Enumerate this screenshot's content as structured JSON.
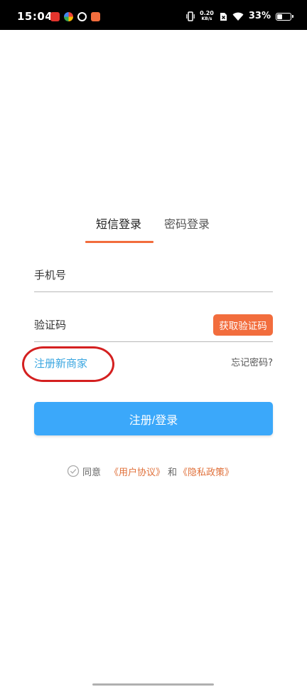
{
  "status_bar": {
    "time": "15:04",
    "net_speed_value": "0.20",
    "net_speed_unit": "KB/s",
    "battery_percent": "33%",
    "battery_level": 0.33
  },
  "tabs": [
    {
      "label": "短信登录",
      "active": true
    },
    {
      "label": "密码登录",
      "active": false
    }
  ],
  "form": {
    "phone_placeholder": "手机号",
    "code_placeholder": "验证码",
    "get_code_label": "获取验证码",
    "register_label": "注册新商家",
    "forgot_label": "忘记密码?",
    "submit_label": "注册/登录"
  },
  "agreement": {
    "agree_text": "同意",
    "user_agreement": "《用户协议》",
    "and_text": "和",
    "privacy_policy": "《隐私政策》"
  },
  "colors": {
    "accent_orange": "#f26d3d",
    "primary_blue": "#3ba8fa",
    "link_blue": "#3aa6e0",
    "highlight_red": "#d42020"
  }
}
